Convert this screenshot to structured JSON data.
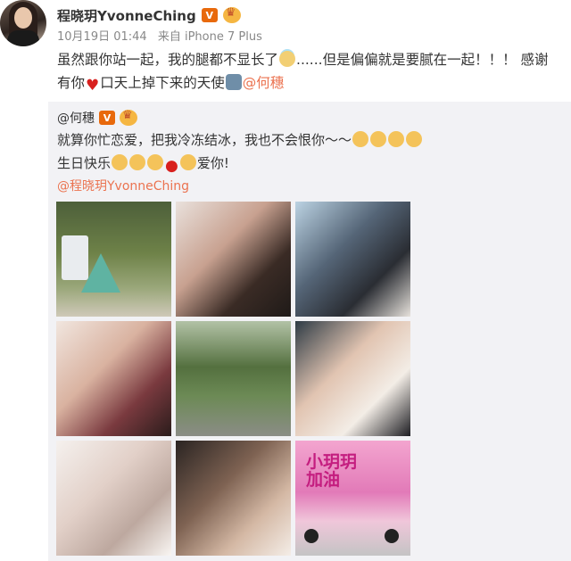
{
  "author": {
    "name": "程晓玥YvonneChing",
    "badge_v": "V",
    "time": "10月19日 01:44",
    "source": "来自 iPhone 7 Plus"
  },
  "post": {
    "line1": "虽然跟你站一起，我的腿都不显长了",
    "line1b": "......但是偏偏就是要腻在一起！！！ 感谢",
    "line2a": "有你",
    "line2b": "口天上掉下来的天使",
    "mention": "@何穗"
  },
  "repost": {
    "user": "@何穗",
    "badge_v": "V",
    "line1": "就算你忙恋爱，把我冷冻结冰，我也不会恨你～～",
    "line2a": "生日快乐",
    "line2b": "爱你!",
    "source_link": "@程晓玥YvonneChing"
  },
  "photos": [
    {
      "label": "photo-1"
    },
    {
      "label": "photo-2"
    },
    {
      "label": "photo-3"
    },
    {
      "label": "photo-4"
    },
    {
      "label": "photo-5"
    },
    {
      "label": "photo-6"
    },
    {
      "label": "photo-7"
    },
    {
      "label": "photo-8"
    },
    {
      "label": "photo-9",
      "truck_text": "小玥玥\n加油"
    }
  ]
}
